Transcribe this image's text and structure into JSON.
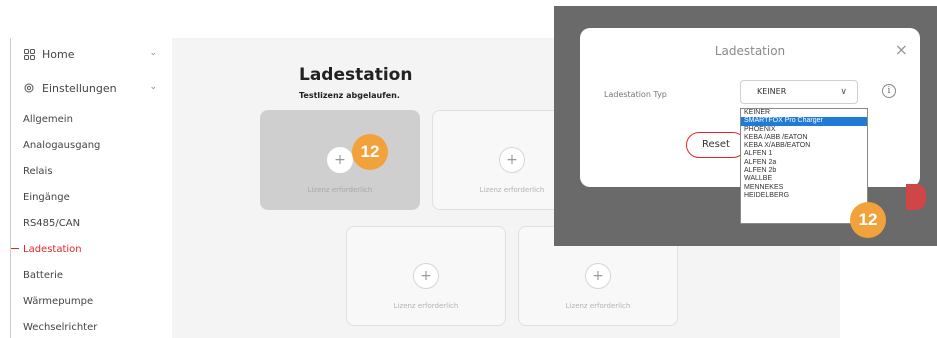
{
  "sidebar": {
    "home_label": "Home",
    "settings_label": "Einstellungen",
    "items": [
      "Allgemein",
      "Analogausgang",
      "Relais",
      "Eingänge",
      "RS485/CAN",
      "Ladestation",
      "Batterie",
      "Wärmepumpe",
      "Wechselrichter"
    ],
    "active_item": "Ladestation"
  },
  "main": {
    "title": "Ladestation",
    "subtitle": "Testlizenz abgelaufen.",
    "card_plus": "+",
    "license_text": "Lizenz erforderlich",
    "badge": "12"
  },
  "modal": {
    "title": "Ladestation",
    "close": "×",
    "field_label": "Ladestation Typ",
    "select_value": "KEINER",
    "select_arrow": "∨",
    "info": "i",
    "reset_label": "Reset",
    "options": [
      "KEINER",
      "SMARTFOX Pro Charger",
      "PHOENIX",
      "KEBA /ABB /EATON",
      "KEBA X/ABB/EATON",
      "ALFEN 1",
      "ALFEN 2a",
      "ALFEN 2b",
      "WALLBE",
      "MENNEKES",
      "HEIDELBERG"
    ],
    "selected_option": "SMARTFOX Pro Charger",
    "badge": "12"
  },
  "colors": {
    "accent": "#e3262b",
    "badge": "#f2a23a",
    "selection": "#1f7bd6"
  }
}
